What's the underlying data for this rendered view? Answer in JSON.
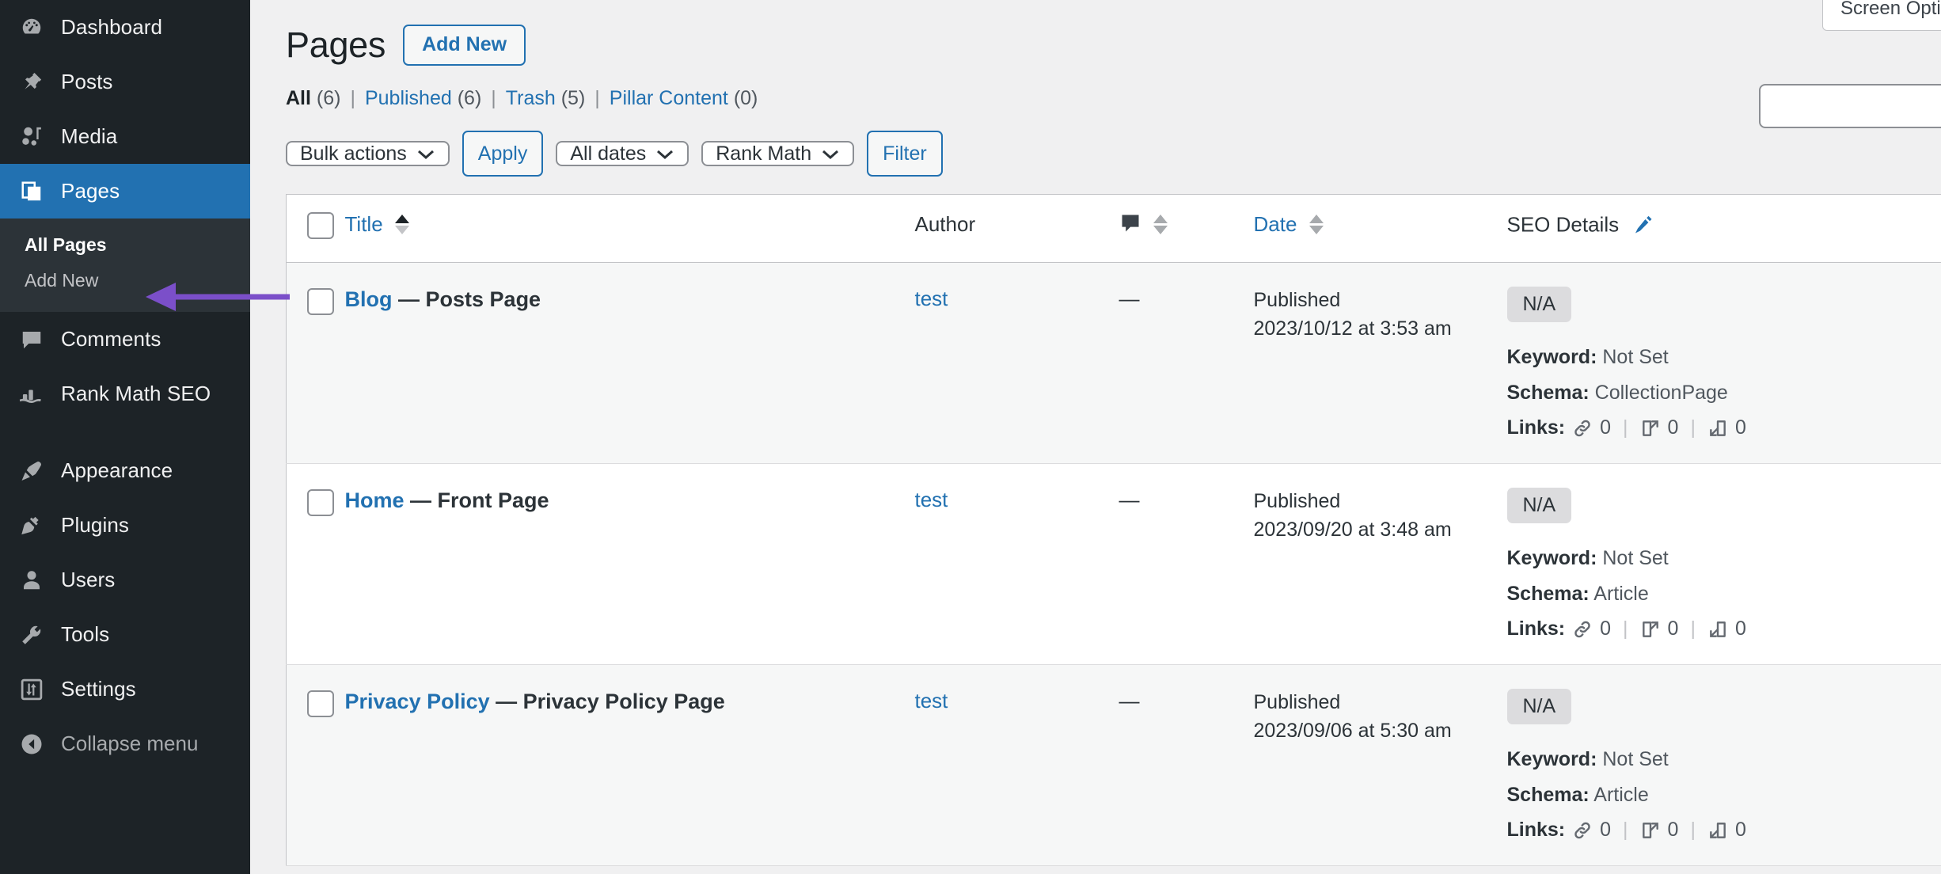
{
  "sidebar": {
    "items": [
      {
        "label": "Dashboard",
        "icon": "dashboard-icon"
      },
      {
        "label": "Posts",
        "icon": "pin-icon"
      },
      {
        "label": "Media",
        "icon": "media-icon"
      },
      {
        "label": "Pages",
        "icon": "pages-icon"
      },
      {
        "label": "Comments",
        "icon": "comment-icon"
      },
      {
        "label": "Rank Math SEO",
        "icon": "rankmath-icon"
      },
      {
        "label": "Appearance",
        "icon": "brush-icon"
      },
      {
        "label": "Plugins",
        "icon": "plug-icon"
      },
      {
        "label": "Users",
        "icon": "user-icon"
      },
      {
        "label": "Tools",
        "icon": "wrench-icon"
      },
      {
        "label": "Settings",
        "icon": "sliders-icon"
      }
    ],
    "submenu": [
      {
        "label": "All Pages"
      },
      {
        "label": "Add New"
      }
    ],
    "collapse": {
      "label": "Collapse menu",
      "icon": "arrow-left-circle-icon"
    },
    "active_item": "Pages",
    "active_submenu": "All Pages",
    "accent_color": "#2271b1",
    "background_color": "#1d2327"
  },
  "header": {
    "screen_options_label": "Screen Options",
    "title": "Pages",
    "add_new_label": "Add New",
    "search_value": "",
    "search_placeholder": ""
  },
  "status_filters": [
    {
      "label": "All",
      "count": "(6)",
      "current": true
    },
    {
      "label": "Published",
      "count": "(6)",
      "current": false
    },
    {
      "label": "Trash",
      "count": "(5)",
      "current": false
    },
    {
      "label": "Pillar Content",
      "count": "(0)",
      "current": false
    }
  ],
  "separator": "|",
  "tablenav": {
    "bulk_actions_value": "Bulk actions",
    "apply_label": "Apply",
    "dates_value": "All dates",
    "rank_math_value": "Rank Math",
    "filter_label": "Filter"
  },
  "table": {
    "columns": {
      "title": "Title",
      "author": "Author",
      "comments": "comments-icon",
      "date": "Date",
      "seo": "SEO Details",
      "seo_edit_icon": "pencil-icon"
    },
    "rows": [
      {
        "title": "Blog",
        "suffix": "— Posts Page",
        "author": "test",
        "comments": "—",
        "date_status": "Published",
        "date_value": "2023/10/12 at 3:53 am",
        "score_badge": "N/A",
        "keyword_label": "Keyword:",
        "keyword_value": "Not Set",
        "schema_label": "Schema:",
        "schema_value": "CollectionPage",
        "links_label": "Links:",
        "links_internal": "0",
        "links_external": "0",
        "links_incoming": "0"
      },
      {
        "title": "Home",
        "suffix": "— Front Page",
        "author": "test",
        "comments": "—",
        "date_status": "Published",
        "date_value": "2023/09/20 at 3:48 am",
        "score_badge": "N/A",
        "keyword_label": "Keyword:",
        "keyword_value": "Not Set",
        "schema_label": "Schema:",
        "schema_value": "Article",
        "links_label": "Links:",
        "links_internal": "0",
        "links_external": "0",
        "links_incoming": "0"
      },
      {
        "title": "Privacy Policy",
        "suffix": "— Privacy Policy Page",
        "author": "test",
        "comments": "—",
        "date_status": "Published",
        "date_value": "2023/09/06 at 5:30 am",
        "score_badge": "N/A",
        "keyword_label": "Keyword:",
        "keyword_value": "Not Set",
        "schema_label": "Schema:",
        "schema_value": "Article",
        "links_label": "Links:",
        "links_internal": "0",
        "links_external": "0",
        "links_incoming": "0"
      }
    ]
  },
  "annotation": {
    "arrow_color": "#7b4fc9",
    "points_to": "All Pages"
  }
}
